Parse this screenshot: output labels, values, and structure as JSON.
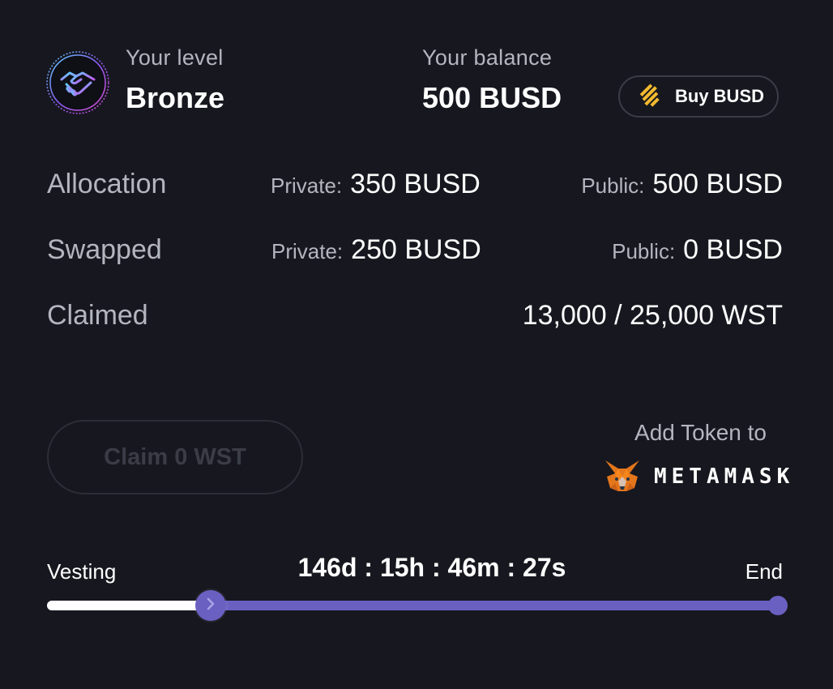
{
  "level": {
    "label": "Your level",
    "value": "Bronze",
    "icon": "handshake-icon"
  },
  "balance": {
    "label": "Your balance",
    "value": "500 BUSD"
  },
  "buy_button": {
    "label": "Buy BUSD",
    "icon": "binance-icon"
  },
  "allocation": {
    "label": "Allocation",
    "private_key": "Private:",
    "private_value": "350 BUSD",
    "public_key": "Public:",
    "public_value": "500 BUSD"
  },
  "swapped": {
    "label": "Swapped",
    "private_key": "Private:",
    "private_value": "250 BUSD",
    "public_key": "Public:",
    "public_value": "0 BUSD"
  },
  "claimed": {
    "label": "Claimed",
    "value": "13,000 / 25,000 WST"
  },
  "claim_button": {
    "label": "Claim 0 WST",
    "enabled": false
  },
  "add_token": {
    "label": "Add Token to",
    "wallet": "METAMASK",
    "icon": "metamask-fox-icon"
  },
  "vesting": {
    "start_label": "Vesting",
    "end_label": "End",
    "countdown": "146d : 15h : 46m : 27s",
    "progress": 0.2235
  },
  "colors": {
    "background": "#17171f",
    "accent": "#6a60c2",
    "muted_text": "#b3b6be",
    "binance": "#f3ba2f",
    "metamask": "#e2761b"
  }
}
